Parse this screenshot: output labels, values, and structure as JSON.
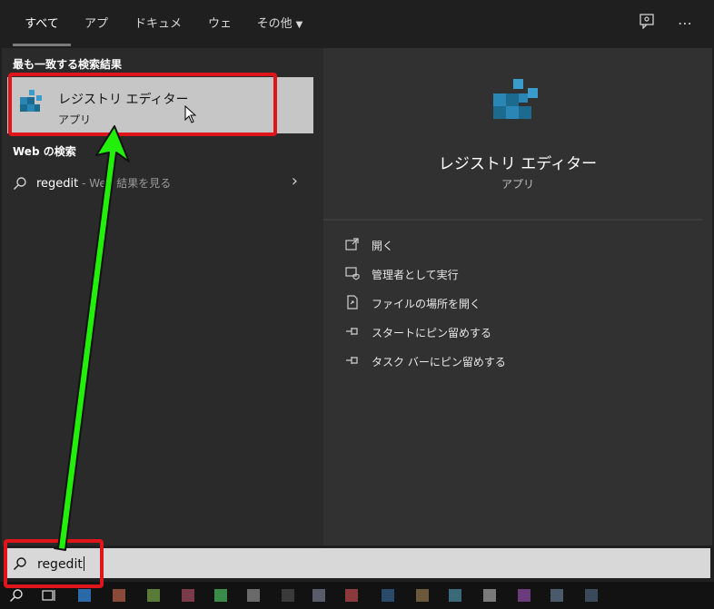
{
  "tabs": [
    {
      "label": "すべて",
      "active": true
    },
    {
      "label": "アプリ"
    },
    {
      "label": "ドキュメント"
    },
    {
      "label": "ウェブ"
    },
    {
      "label": "その他"
    }
  ],
  "top_icons": {
    "feedback": "feedback-icon",
    "more": "⋯"
  },
  "left": {
    "best_match_title": "最も一致する検索結果",
    "best_match": {
      "title": "レジストリ エディター",
      "subtitle": "アプリ"
    },
    "web_title": "Web の検索",
    "web_query": "regedit",
    "web_hint": " - Web 結果を見る"
  },
  "detail": {
    "title": "レジストリ エディター",
    "subtitle": "アプリ",
    "actions": [
      {
        "icon": "open-icon",
        "label": "開く"
      },
      {
        "icon": "admin-icon",
        "label": "管理者として実行"
      },
      {
        "icon": "file-location-icon",
        "label": "ファイルの場所を開く"
      },
      {
        "icon": "pin-start-icon",
        "label": "スタートにピン留めする"
      },
      {
        "icon": "pin-taskbar-icon",
        "label": "タスク バーにピン留めする"
      }
    ]
  },
  "search": {
    "value": "regedit"
  },
  "colors": {
    "highlight_red": "#e0141b",
    "arrow_green": "#22f00a",
    "accent_blue": "#1c6b8f"
  }
}
